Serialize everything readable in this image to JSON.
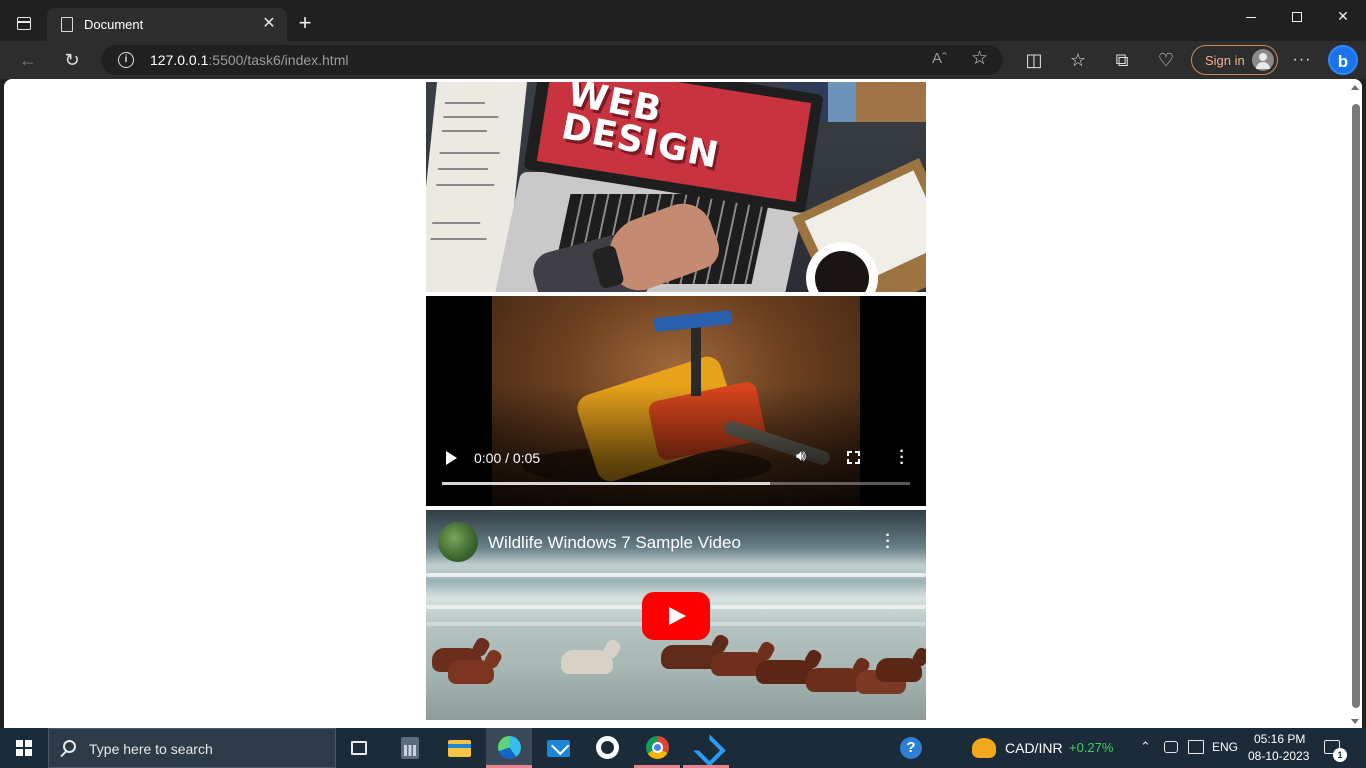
{
  "browser": {
    "tab_title": "Document",
    "tab_close_glyph": "✕",
    "new_tab_glyph": "+",
    "url_host": "127.0.0.1",
    "url_rest": ":5500/task6/index.html",
    "read_aloud_glyph": "Aˆ",
    "sign_in_label": "Sign in",
    "more_glyph": "···",
    "bing_glyph": "b",
    "icons": [
      "tab-actions-icon",
      "document-icon",
      "back-icon",
      "reload-icon",
      "info-icon",
      "read-aloud-icon",
      "favorite-star-icon",
      "split-screen-icon",
      "favorites-icon",
      "collections-icon",
      "browser-essentials-icon",
      "profile-avatar-icon",
      "more-icon",
      "bing-copilot-icon"
    ]
  },
  "page": {
    "hero_image_text": [
      "WEB",
      "DESIGN"
    ],
    "video": {
      "time": "0:00 / 0:05",
      "buffered_fraction": 0.7
    },
    "youtube": {
      "title": "Wildlife Windows 7 Sample Video",
      "play_color": "#ff0000"
    }
  },
  "taskbar": {
    "search_placeholder": "Type here to search",
    "apps": [
      "task-view",
      "calculator",
      "file-explorer",
      "microsoft-edge",
      "mail",
      "github-desktop",
      "google-chrome",
      "visual-studio-code"
    ],
    "help_glyph": "?",
    "stock": {
      "name": "CAD/INR",
      "change": "+0.27%",
      "change_color": "#3ecf5c"
    },
    "language": "ENG",
    "time": "05:16 PM",
    "date": "08-10-2023",
    "notification_count": "1"
  }
}
